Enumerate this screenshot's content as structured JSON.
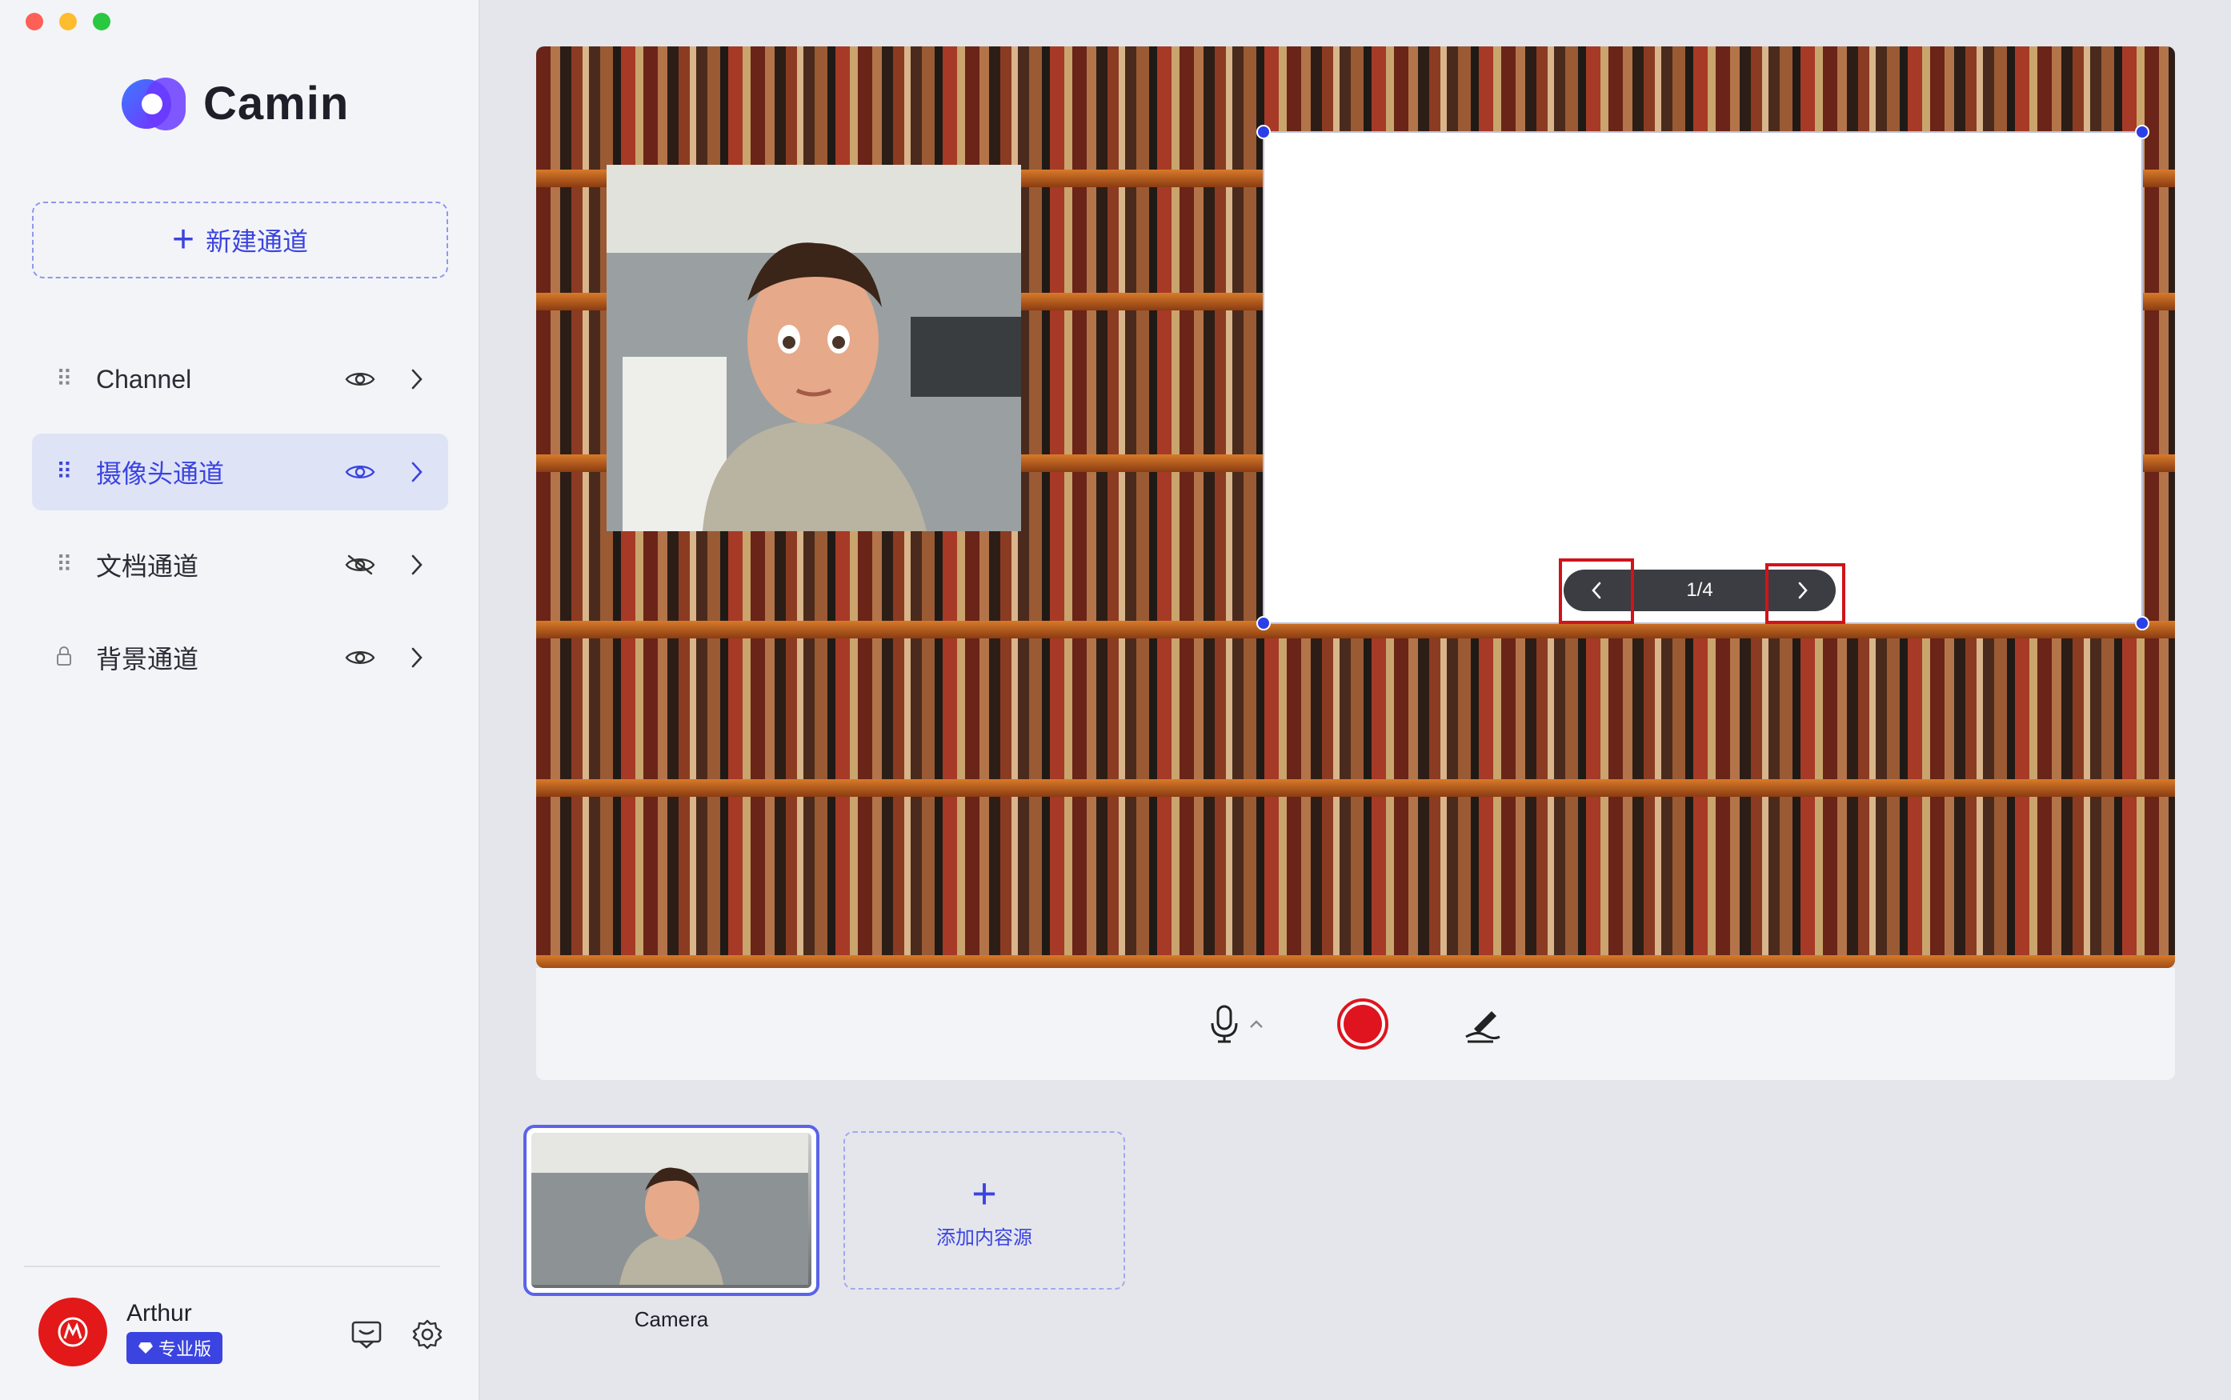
{
  "app": {
    "name": "Camin"
  },
  "sidebar": {
    "new_channel_label": "新建通道",
    "items": [
      {
        "label": "Channel",
        "visible": true,
        "active": false,
        "locked": false
      },
      {
        "label": "摄像头通道",
        "visible": true,
        "active": true,
        "locked": false
      },
      {
        "label": "文档通道",
        "visible": false,
        "active": false,
        "locked": false
      },
      {
        "label": "背景通道",
        "visible": true,
        "active": false,
        "locked": true
      }
    ]
  },
  "user": {
    "name": "Arthur",
    "plan": "专业版"
  },
  "stage": {
    "pager_text": "1/4"
  },
  "sources": {
    "items": [
      {
        "label": "Camera"
      }
    ],
    "add_label": "添加内容源"
  },
  "colors": {
    "accent": "#3b44e0",
    "record": "#e0141e",
    "highlight": "#d0141a"
  }
}
